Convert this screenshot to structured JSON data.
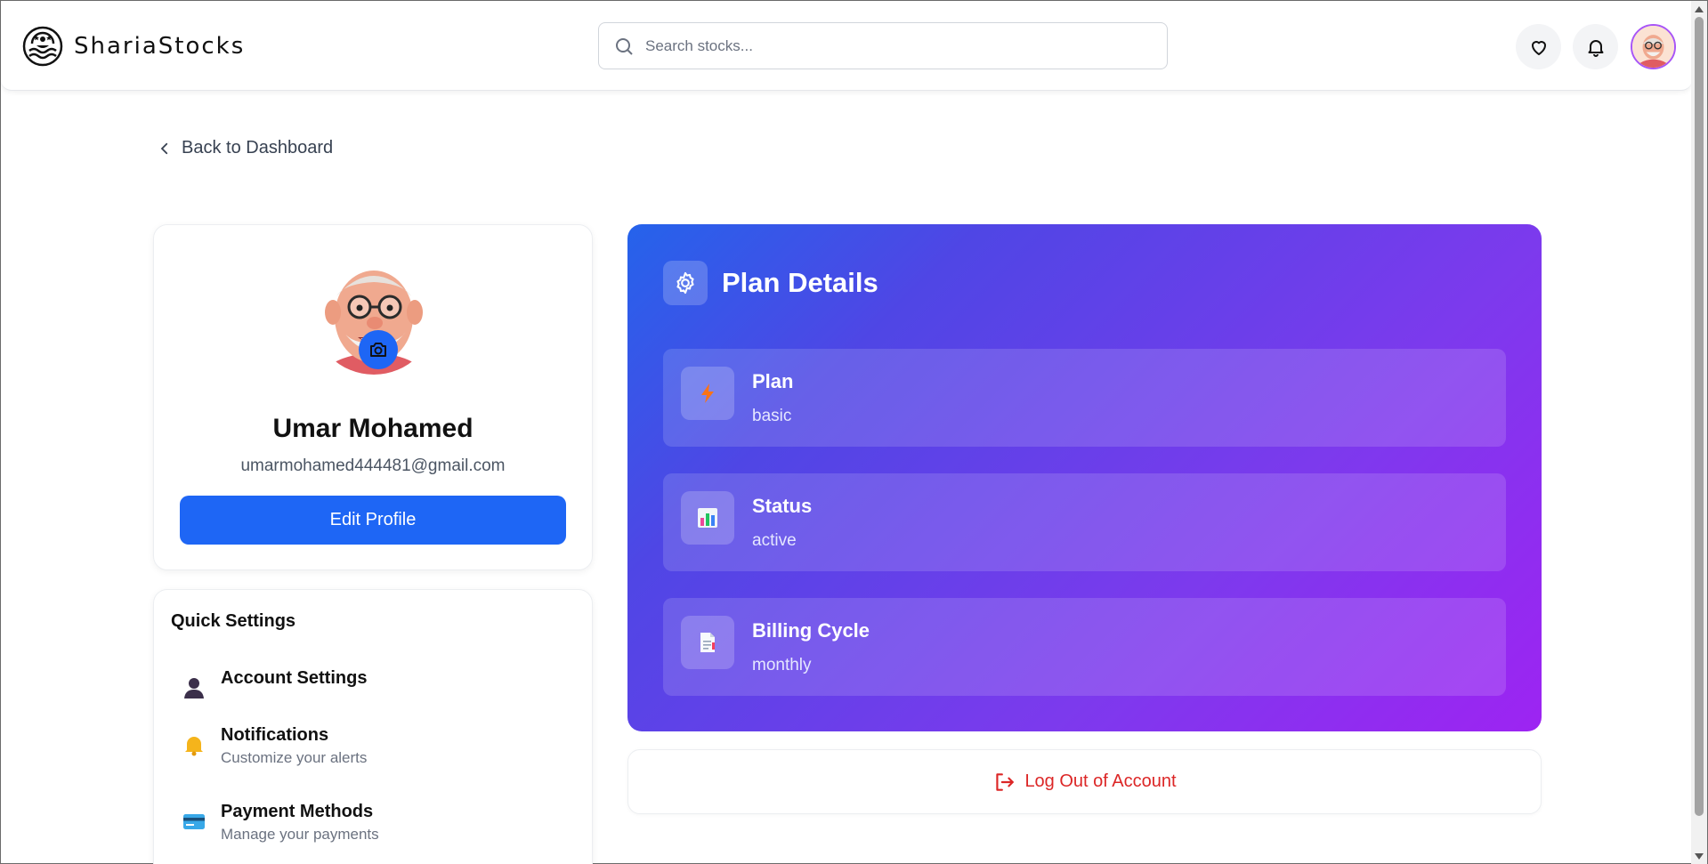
{
  "header": {
    "brand_name": "ShariaStocks",
    "search_placeholder": "Search stocks..."
  },
  "nav": {
    "back_label": "Back to Dashboard"
  },
  "profile": {
    "name": "Umar Mohamed",
    "email": "umarmohamed444481@gmail.com",
    "edit_label": "Edit Profile"
  },
  "quick_settings": {
    "title": "Quick Settings",
    "items": [
      {
        "label": "Account Settings",
        "sub": "",
        "icon": "user-icon"
      },
      {
        "label": "Notifications",
        "sub": "Customize your alerts",
        "icon": "bell-icon"
      },
      {
        "label": "Payment Methods",
        "sub": "Manage your payments",
        "icon": "credit-card-icon"
      }
    ]
  },
  "plan": {
    "title": "Plan Details",
    "rows": [
      {
        "label": "Plan",
        "value": "basic",
        "icon": "lightning-icon"
      },
      {
        "label": "Status",
        "value": "active",
        "icon": "bar-chart-icon"
      },
      {
        "label": "Billing Cycle",
        "value": "monthly",
        "icon": "document-icon"
      }
    ]
  },
  "logout": {
    "label": "Log Out of Account"
  },
  "colors": {
    "primary": "#1e66f5",
    "danger": "#dc2626",
    "gradient_start": "#2563eb",
    "gradient_end": "#9d24f2"
  }
}
